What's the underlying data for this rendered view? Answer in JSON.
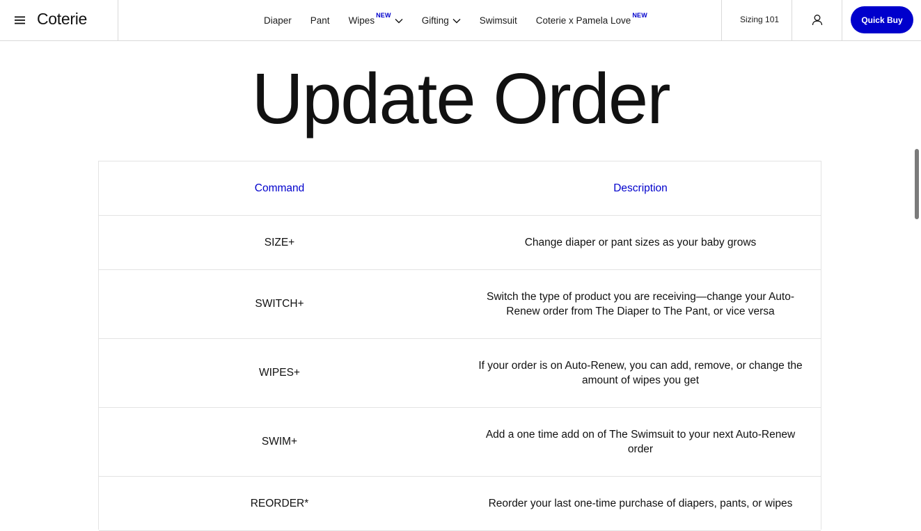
{
  "header": {
    "logo": "Coterie",
    "nav": [
      {
        "label": "Diaper",
        "badge": "",
        "dropdown": false
      },
      {
        "label": "Pant",
        "badge": "",
        "dropdown": false
      },
      {
        "label": "Wipes",
        "badge": "NEW",
        "dropdown": true
      },
      {
        "label": "Gifting",
        "badge": "",
        "dropdown": true
      },
      {
        "label": "Swimsuit",
        "badge": "",
        "dropdown": false
      },
      {
        "label": "Coterie x Pamela Love",
        "badge": "NEW",
        "dropdown": false
      }
    ],
    "sizing_label": "Sizing 101",
    "quick_buy_label": "Quick Buy"
  },
  "page": {
    "title": "Update Order"
  },
  "table": {
    "headers": {
      "command": "Command",
      "description": "Description"
    },
    "rows": [
      {
        "command": "SIZE+",
        "description": "Change diaper or pant sizes as your baby grows"
      },
      {
        "command": "SWITCH+",
        "description": "Switch the type of product you are receiving—change your Auto-Renew order from The Diaper to The Pant, or vice versa"
      },
      {
        "command": "WIPES+",
        "description": "If your order is on Auto-Renew, you can add, remove, or change the amount of wipes you get"
      },
      {
        "command": "SWIM+",
        "description": "Add a one time add on of The Swimsuit to your next Auto-Renew order"
      },
      {
        "command": "REORDER*",
        "description": "Reorder your last one-time purchase of diapers, pants, or wipes"
      }
    ]
  },
  "colors": {
    "accent": "#0000cc",
    "border": "#e3e3e3",
    "text": "#111111"
  }
}
